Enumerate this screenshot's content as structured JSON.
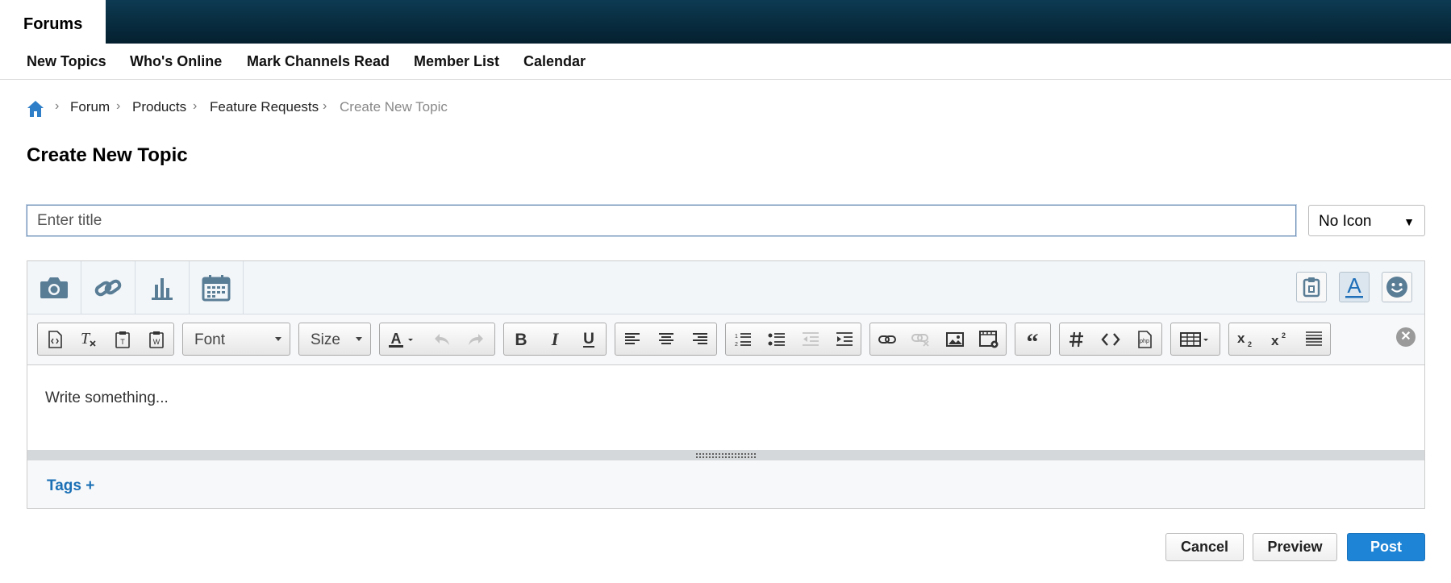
{
  "header": {
    "tab_label": "Forums"
  },
  "subnav": {
    "items": [
      "New Topics",
      "Who's Online",
      "Mark Channels Read",
      "Member List",
      "Calendar"
    ]
  },
  "breadcrumb": {
    "items": [
      "Forum",
      "Products",
      "Feature Requests"
    ],
    "current": "Create New Topic",
    "separator": "›"
  },
  "page": {
    "title": "Create New Topic"
  },
  "title_field": {
    "placeholder": "Enter title",
    "value": ""
  },
  "icon_select": {
    "selected": "No Icon",
    "arrow": "▼"
  },
  "media_toolbar": {
    "buttons": [
      "camera-icon",
      "link-icon",
      "chart-icon",
      "calendar-icon"
    ],
    "right_buttons": [
      "clipboard-icon",
      "text-format-icon",
      "smiley-icon"
    ]
  },
  "toolbar": {
    "font_label": "Font",
    "size_label": "Size",
    "close_symbol": "✕"
  },
  "editor": {
    "placeholder": "Write something..."
  },
  "tags": {
    "label": "Tags +"
  },
  "actions": {
    "cancel": "Cancel",
    "preview": "Preview",
    "post": "Post"
  },
  "colors": {
    "accent": "#1e85d6",
    "link": "#1a6fb5",
    "header_bg": "#04202f",
    "icon": "#5a7d96"
  }
}
